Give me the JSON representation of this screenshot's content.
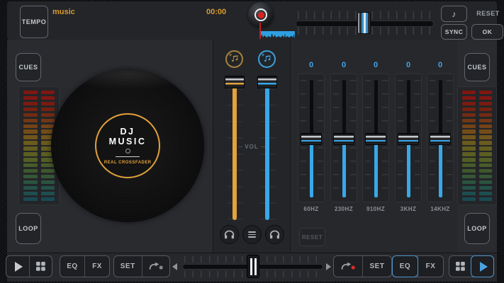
{
  "topbar": {
    "tempo_button": "TEMPO",
    "track_title": "music",
    "elapsed_time": "00:00",
    "reset_label": "RESET",
    "sync_button": "SYNC",
    "ok_button": "OK",
    "note_glyph": "♪"
  },
  "deck_left": {
    "cues_button": "CUES",
    "loop_button": "LOOP"
  },
  "deck_right": {
    "cues_button": "CUES",
    "loop_button": "LOOP"
  },
  "vinyl_label": {
    "line1": "DJ",
    "line2": "MUSIC",
    "tagline": "REAL CROSSFADER"
  },
  "mixer": {
    "vol_label": "VOL"
  },
  "equalizer": {
    "values": [
      "0",
      "0",
      "0",
      "0",
      "0"
    ],
    "bands": [
      "60HZ",
      "230HZ",
      "910HZ",
      "3KHZ",
      "14KHZ"
    ],
    "reset_button": "RESET"
  },
  "bottom_bar": {
    "left_eq": "EQ",
    "left_fx": "FX",
    "left_set": "SET",
    "right_set": "SET",
    "right_eq": "EQ",
    "right_fx": "FX"
  },
  "meters": {
    "colors": [
      "#7E1712",
      "#811811",
      "#7B1B10",
      "#742110",
      "#712B12",
      "#723715",
      "#754217",
      "#744C18",
      "#70551A",
      "#6B5B1D",
      "#635D1F",
      "#5A5E21",
      "#515E24",
      "#475C28",
      "#3E592E",
      "#345736",
      "#2B543F",
      "#235148",
      "#1D4E4F",
      "#184A53"
    ]
  },
  "colors": {
    "accent_gold": "#E3A23C",
    "accent_blue": "#38A8E8",
    "accent_yellow_text": "#D89B2E",
    "record_red": "#E02020"
  }
}
